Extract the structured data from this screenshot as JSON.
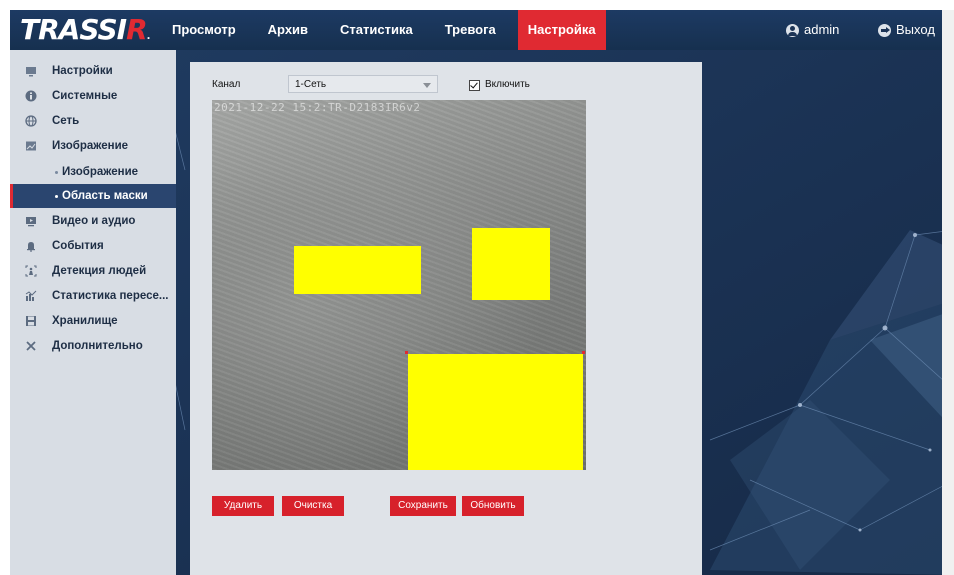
{
  "header": {
    "logo_text_main": "TRASSI",
    "logo_text_accent": "R",
    "nav": [
      {
        "label": "Просмотр",
        "active": false
      },
      {
        "label": "Архив",
        "active": false
      },
      {
        "label": "Статистика",
        "active": false
      },
      {
        "label": "Тревога",
        "active": false
      },
      {
        "label": "Настройка",
        "active": true
      }
    ],
    "user_label": "admin",
    "user_icon": "user-icon",
    "logout_label": "Выход",
    "logout_icon": "logout-icon"
  },
  "sidebar": {
    "items": [
      {
        "label": "Настройки",
        "icon": "monitor-icon"
      },
      {
        "label": "Системные",
        "icon": "info-icon"
      },
      {
        "label": "Сеть",
        "icon": "globe-icon"
      },
      {
        "label": "Изображение",
        "icon": "image-icon"
      },
      {
        "label": "Изображение",
        "sub": true
      },
      {
        "label": "Область маски",
        "sub": true,
        "active": true
      },
      {
        "label": "Видео и аудио",
        "icon": "video-icon"
      },
      {
        "label": "События",
        "icon": "bell-icon"
      },
      {
        "label": "Детекция людей",
        "icon": "person-detect-icon"
      },
      {
        "label": "Статистика пересе...",
        "icon": "bar-chart-icon"
      },
      {
        "label": "Хранилище",
        "icon": "floppy-icon"
      },
      {
        "label": "Дополнительно",
        "icon": "tools-icon"
      }
    ]
  },
  "settings": {
    "channel_label": "Канал",
    "channel_value": "1-Сеть",
    "enable_label": "Включить",
    "enable_checked": true
  },
  "video": {
    "osd_text": "2021-12-22 15:2:TR-D2183IR6v2"
  },
  "buttons": {
    "delete": "Удалить",
    "clear": "Очистка",
    "save": "Сохранить",
    "refresh": "Обновить"
  },
  "colors": {
    "accent": "#e02a32",
    "mask": "#ffff00",
    "header_bg": "#1c3456",
    "sidebar_bg": "#d8dde4",
    "panel_bg": "#dfe3e8"
  }
}
